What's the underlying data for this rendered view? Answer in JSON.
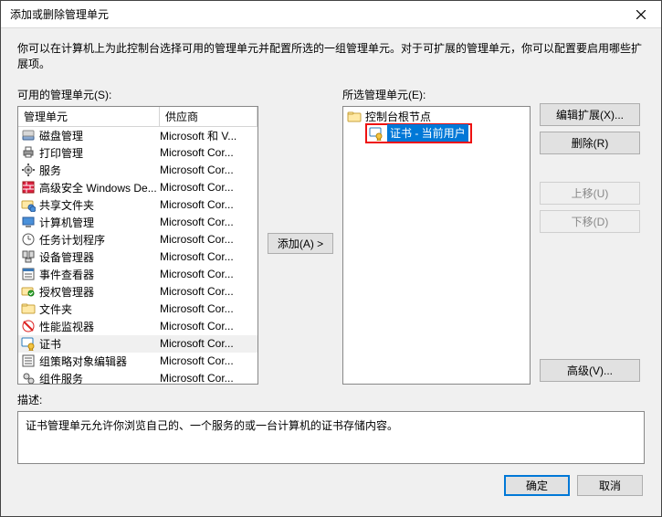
{
  "window": {
    "title": "添加或删除管理单元"
  },
  "intro": "你可以在计算机上为此控制台选择可用的管理单元并配置所选的一组管理单元。对于可扩展的管理单元，你可以配置要启用哪些扩展项。",
  "available": {
    "label": "可用的管理单元(S):",
    "columns": {
      "snapin": "管理单元",
      "vendor": "供应商"
    },
    "items": [
      {
        "name": "磁盘管理",
        "vendor": "Microsoft 和 V...",
        "icon": "disk-icon"
      },
      {
        "name": "打印管理",
        "vendor": "Microsoft Cor...",
        "icon": "printer-icon"
      },
      {
        "name": "服务",
        "vendor": "Microsoft Cor...",
        "icon": "gear-icon"
      },
      {
        "name": "高级安全 Windows De...",
        "vendor": "Microsoft Cor...",
        "icon": "firewall-icon"
      },
      {
        "name": "共享文件夹",
        "vendor": "Microsoft Cor...",
        "icon": "shared-folder-icon"
      },
      {
        "name": "计算机管理",
        "vendor": "Microsoft Cor...",
        "icon": "computer-mgmt-icon"
      },
      {
        "name": "任务计划程序",
        "vendor": "Microsoft Cor...",
        "icon": "task-scheduler-icon"
      },
      {
        "name": "设备管理器",
        "vendor": "Microsoft Cor...",
        "icon": "device-mgr-icon"
      },
      {
        "name": "事件查看器",
        "vendor": "Microsoft Cor...",
        "icon": "event-viewer-icon"
      },
      {
        "name": "授权管理器",
        "vendor": "Microsoft Cor...",
        "icon": "auth-mgr-icon"
      },
      {
        "name": "文件夹",
        "vendor": "Microsoft Cor...",
        "icon": "folder-icon"
      },
      {
        "name": "性能监视器",
        "vendor": "Microsoft Cor...",
        "icon": "perfmon-icon"
      },
      {
        "name": "证书",
        "vendor": "Microsoft Cor...",
        "icon": "certificate-icon",
        "selected": true
      },
      {
        "name": "组策略对象编辑器",
        "vendor": "Microsoft Cor...",
        "icon": "gpo-icon"
      },
      {
        "name": "组件服务",
        "vendor": "Microsoft Cor...",
        "icon": "component-icon"
      }
    ]
  },
  "add_button": "添加(A) >",
  "selected_section": {
    "label": "所选管理单元(E):",
    "root": "控制台根节点",
    "items": [
      {
        "name": "证书 - 当前用户",
        "icon": "certificate-icon"
      }
    ]
  },
  "side_buttons": {
    "edit_ext": "编辑扩展(X)...",
    "remove": "删除(R)",
    "move_up": "上移(U)",
    "move_down": "下移(D)",
    "advanced": "高级(V)..."
  },
  "description": {
    "label": "描述:",
    "text": "证书管理单元允许你浏览自己的、一个服务的或一台计算机的证书存储内容。"
  },
  "footer": {
    "ok": "确定",
    "cancel": "取消"
  }
}
